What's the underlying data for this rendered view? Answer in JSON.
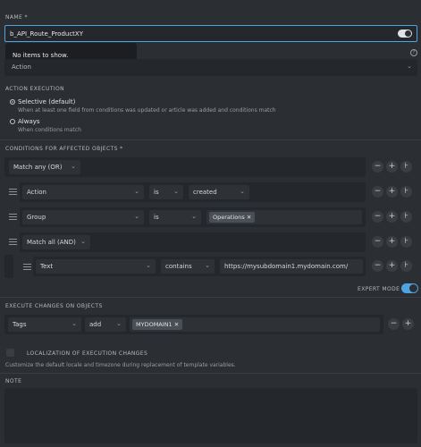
{
  "name": {
    "label": "NAME *",
    "value": "b_API_Route_ProductXY",
    "dropdown_message": "No items to show."
  },
  "trigger_select_value": "Action",
  "action_execution": {
    "label": "ACTION EXECUTION",
    "options": [
      {
        "label": "Selective (default)",
        "desc": "When at least one field from conditions was updated or article was added and conditions match",
        "selected": true
      },
      {
        "label": "Always",
        "desc": "When conditions match",
        "selected": false
      }
    ]
  },
  "conditions": {
    "label": "CONDITIONS FOR AFFECTED OBJECTS *",
    "match_any": "Match any (OR)",
    "row_action": {
      "attribute": "Action",
      "operator": "is",
      "value": "created"
    },
    "row_group": {
      "attribute": "Group",
      "operator": "is",
      "tag": "Operations"
    },
    "match_all": "Match all (AND)",
    "row_text": {
      "attribute": "Text",
      "operator": "contains",
      "value": "https://mysubdomain1.mydomain.com/"
    }
  },
  "expert_mode": {
    "label": "EXPERT MODE",
    "on": true
  },
  "execute_changes": {
    "label": "EXECUTE CHANGES ON OBJECTS",
    "attribute": "Tags",
    "operator": "add",
    "tag": "MYDOMAIN1"
  },
  "localization": {
    "label": "LOCALIZATION OF EXECUTION CHANGES",
    "desc": "Customize the default locale and timezone during replacement of template variables."
  },
  "note": {
    "label": "NOTE"
  },
  "colors": {
    "accent": "#50a3e1",
    "background": "#2b2e33",
    "field": "#24272b"
  }
}
